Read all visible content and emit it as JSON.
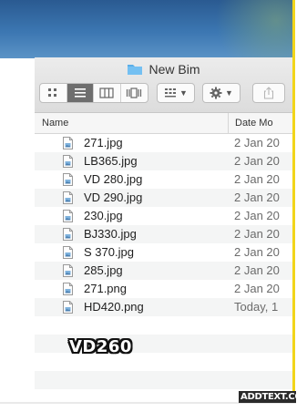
{
  "window": {
    "title": "New Bim"
  },
  "toolbar": {
    "view_modes": [
      "icon-view",
      "list-view",
      "column-view",
      "cover-flow-view"
    ],
    "active_view": "list-view",
    "arrange_icon": "grid-arrange-icon",
    "action_icon": "gear-icon",
    "share_icon": "share-icon"
  },
  "columns": {
    "name": "Name",
    "date": "Date Mo"
  },
  "files": [
    {
      "name": "271.jpg",
      "date": "2 Jan 20"
    },
    {
      "name": "LB365.jpg",
      "date": "2 Jan 20"
    },
    {
      "name": "VD 280.jpg",
      "date": "2 Jan 20"
    },
    {
      "name": "VD 290.jpg",
      "date": "2 Jan 20"
    },
    {
      "name": "230.jpg",
      "date": "2 Jan 20"
    },
    {
      "name": "BJ330.jpg",
      "date": "2 Jan 20"
    },
    {
      "name": "S 370.jpg",
      "date": "2 Jan 20"
    },
    {
      "name": "285.jpg",
      "date": "2 Jan 20"
    },
    {
      "name": "271.png",
      "date": "2 Jan 20"
    },
    {
      "name": "HD420.png",
      "date": "Today, 1"
    }
  ],
  "caption": "VD260",
  "watermark": "ADDTEXT.COM",
  "colors": {
    "border_accent": "#f2d51a",
    "active_view": "#6e6e6e",
    "folder": "#5aaee8"
  }
}
